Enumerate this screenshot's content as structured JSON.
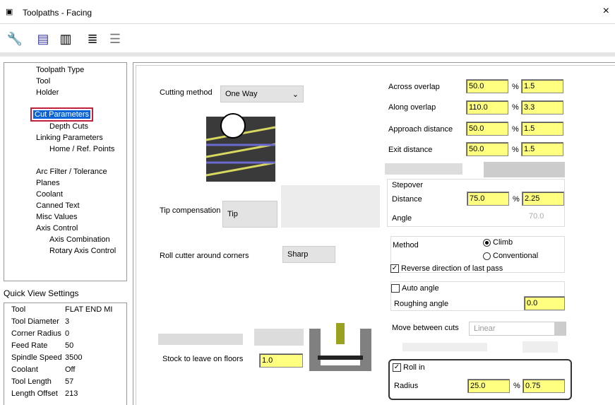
{
  "window": {
    "title": "Toolpaths - Facing",
    "close": "×"
  },
  "toolbar": {
    "icons": [
      "tool-icon",
      "save-icon",
      "library-icon",
      "copy-params-icon",
      "paste-params-icon"
    ]
  },
  "tree": {
    "items": [
      "Toolpath Type",
      "Tool",
      "Holder",
      "Cut Parameters",
      "Depth Cuts",
      "Linking Parameters",
      "Home / Ref. Points",
      "Arc Filter / Tolerance",
      "Planes",
      "Coolant",
      "Canned Text",
      "Misc Values",
      "Axis Control",
      "Axis Combination",
      "Rotary Axis Control"
    ],
    "selected": "Cut Parameters"
  },
  "quick_view": {
    "label": "Quick View Settings",
    "rows": [
      {
        "k": "Tool",
        "v": "FLAT END MI"
      },
      {
        "k": "Tool Diameter",
        "v": "3"
      },
      {
        "k": "Corner Radius",
        "v": "0"
      },
      {
        "k": "Feed Rate",
        "v": "50"
      },
      {
        "k": "Spindle Speed",
        "v": "3500"
      },
      {
        "k": "Coolant",
        "v": "Off"
      },
      {
        "k": "Tool Length",
        "v": "57"
      },
      {
        "k": "Length Offset",
        "v": "213"
      }
    ]
  },
  "params": {
    "cutting_method": {
      "label": "Cutting method",
      "value": "One Way"
    },
    "tip_comp": {
      "label": "Tip compensation",
      "value": "Tip"
    },
    "roll_cutter": {
      "label": "Roll cutter around corners",
      "value": "Sharp"
    },
    "stock_floors": {
      "label": "Stock to leave on floors",
      "value": "1.0"
    },
    "across": {
      "label": "Across overlap",
      "pct": "50.0",
      "val": "1.5"
    },
    "along": {
      "label": "Along overlap",
      "pct": "110.0",
      "val": "3.3"
    },
    "approach": {
      "label": "Approach distance",
      "pct": "50.0",
      "val": "1.5"
    },
    "exit": {
      "label": "Exit distance",
      "pct": "50.0",
      "val": "1.5"
    },
    "pct_sign": "%",
    "stepover": {
      "label": "Stepover",
      "distance_label": "Distance",
      "pct": "75.0",
      "val": "2.25",
      "angle_label": "Angle",
      "angle": "70.0"
    },
    "method": {
      "label": "Method",
      "climb": "Climb",
      "conventional": "Conventional",
      "selected": "Climb"
    },
    "reverse_last": {
      "label": "Reverse direction of last pass",
      "checked": true
    },
    "auto_angle": {
      "label": "Auto angle",
      "checked": false
    },
    "roughing_angle": {
      "label": "Roughing angle",
      "value": "0.0"
    },
    "move_between": {
      "label": "Move between cuts",
      "value": "Linear"
    },
    "roll_in": {
      "label": "Roll in",
      "checked": true,
      "radius_label": "Radius",
      "pct": "25.0",
      "val": "0.75"
    }
  }
}
